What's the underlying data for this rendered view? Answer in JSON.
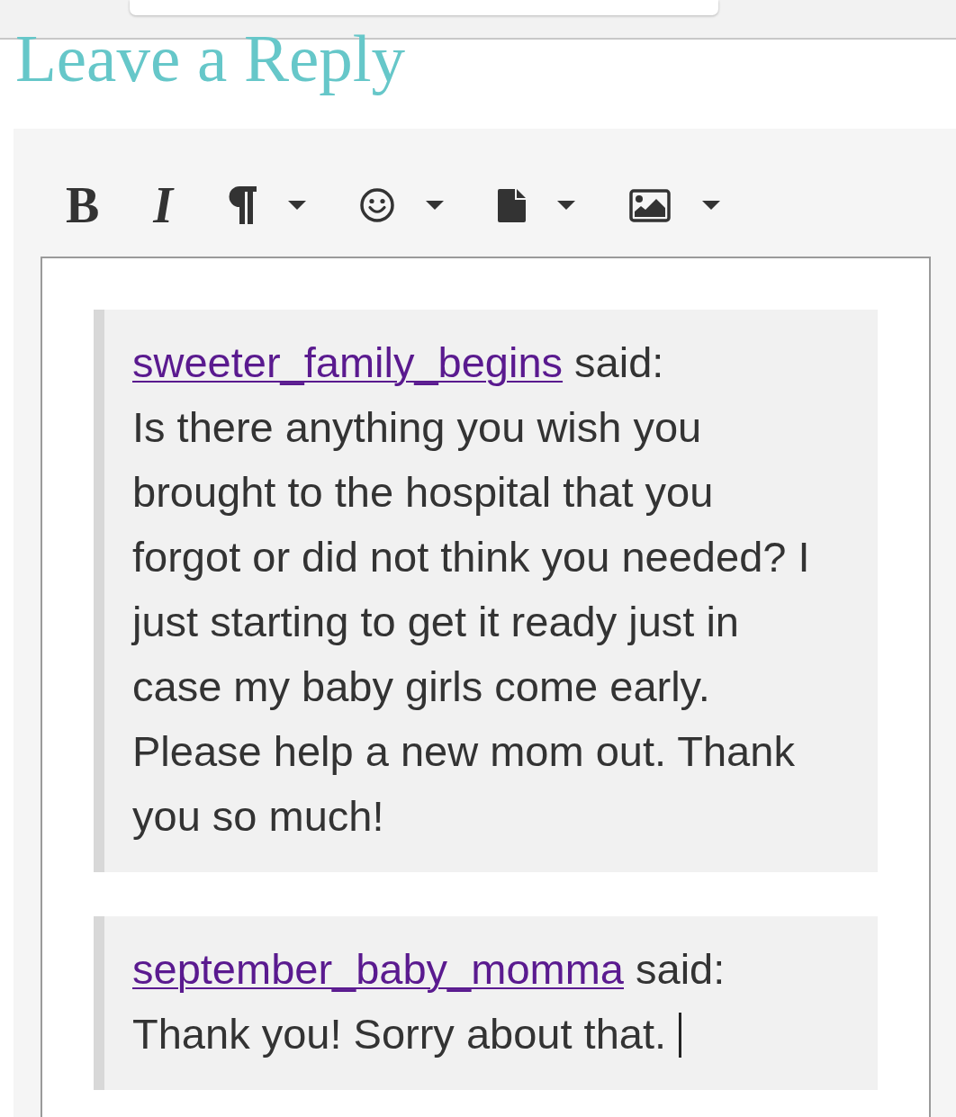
{
  "heading": "Leave a Reply",
  "toolbar": [
    {
      "kind": "bold",
      "label": "B",
      "dropdown": false
    },
    {
      "kind": "italic",
      "label": "I",
      "dropdown": false
    },
    {
      "kind": "paragraph",
      "dropdown": true
    },
    {
      "kind": "emoji",
      "dropdown": true
    },
    {
      "kind": "file",
      "dropdown": true
    },
    {
      "kind": "image",
      "dropdown": true
    }
  ],
  "editor": {
    "quotes": [
      {
        "author": "sweeter_family_begins",
        "said": "said:",
        "text": "Is there anything you wish you brought to the hospital that you forgot or did not think you needed? I just starting to get it ready just in case my baby girls come early. Please help a new mom out. Thank you so much!",
        "has_cursor": false
      },
      {
        "author": "september_baby_momma",
        "said": "said:",
        "text": "Thank you! Sorry about that.",
        "has_cursor": true
      }
    ]
  }
}
